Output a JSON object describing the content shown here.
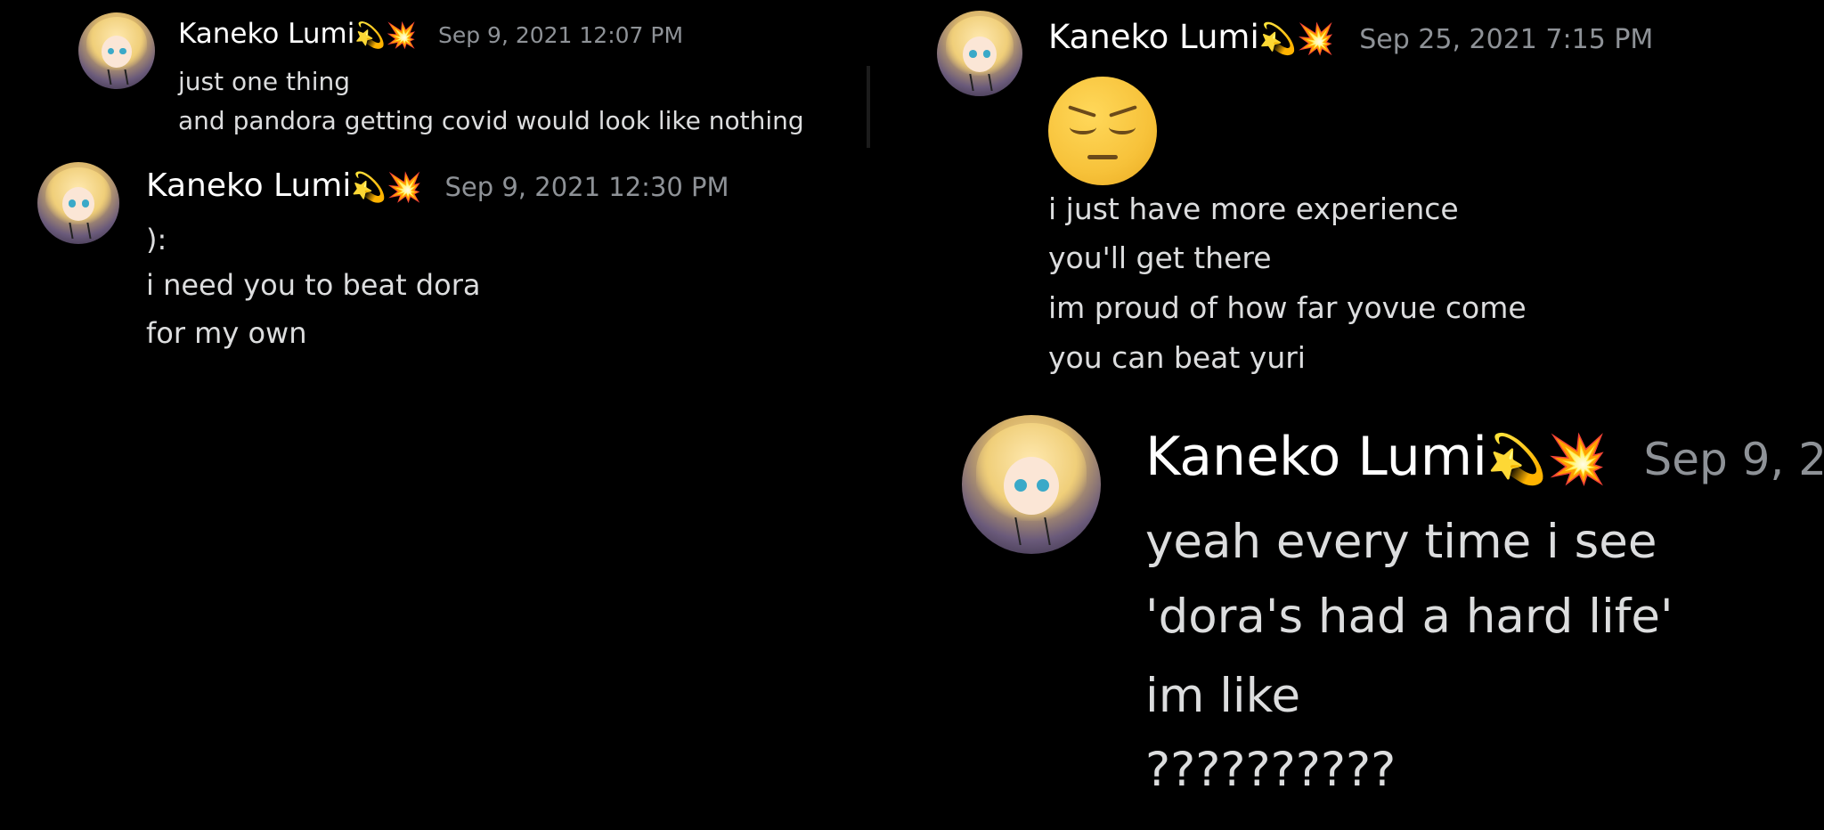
{
  "left_panel": {
    "msg1": {
      "author": "Kaneko Lumi",
      "timestamp": "Sep 9, 2021 12:07 PM",
      "lines": [
        "just one thing",
        "and pandora getting covid would look like nothing"
      ]
    },
    "msg2": {
      "author": "Kaneko Lumi",
      "timestamp": "Sep 9, 2021 12:30 PM",
      "lines": [
        "):",
        "i need you to beat dora",
        "for my own"
      ]
    }
  },
  "right_panel": {
    "msg1": {
      "author": "Kaneko Lumi",
      "timestamp": "Sep 25, 2021 7:15 PM",
      "emoji": "pensive-face",
      "lines": [
        "i just have more experience",
        "you'll get there",
        "im proud of how far yovue come",
        "you can beat yuri"
      ]
    },
    "msg2": {
      "author": "Kaneko Lumi",
      "timestamp": "Sep 9, 2",
      "lines": [
        "yeah every time i see",
        "'dora's had a hard life'",
        "im like",
        "??????????"
      ]
    }
  },
  "badges": {
    "dizzy": "💫",
    "collision": "💥"
  },
  "colors": {
    "background": "#000000",
    "name": "#ffffff",
    "timestamp": "#8e9297",
    "text": "#dcddde"
  }
}
